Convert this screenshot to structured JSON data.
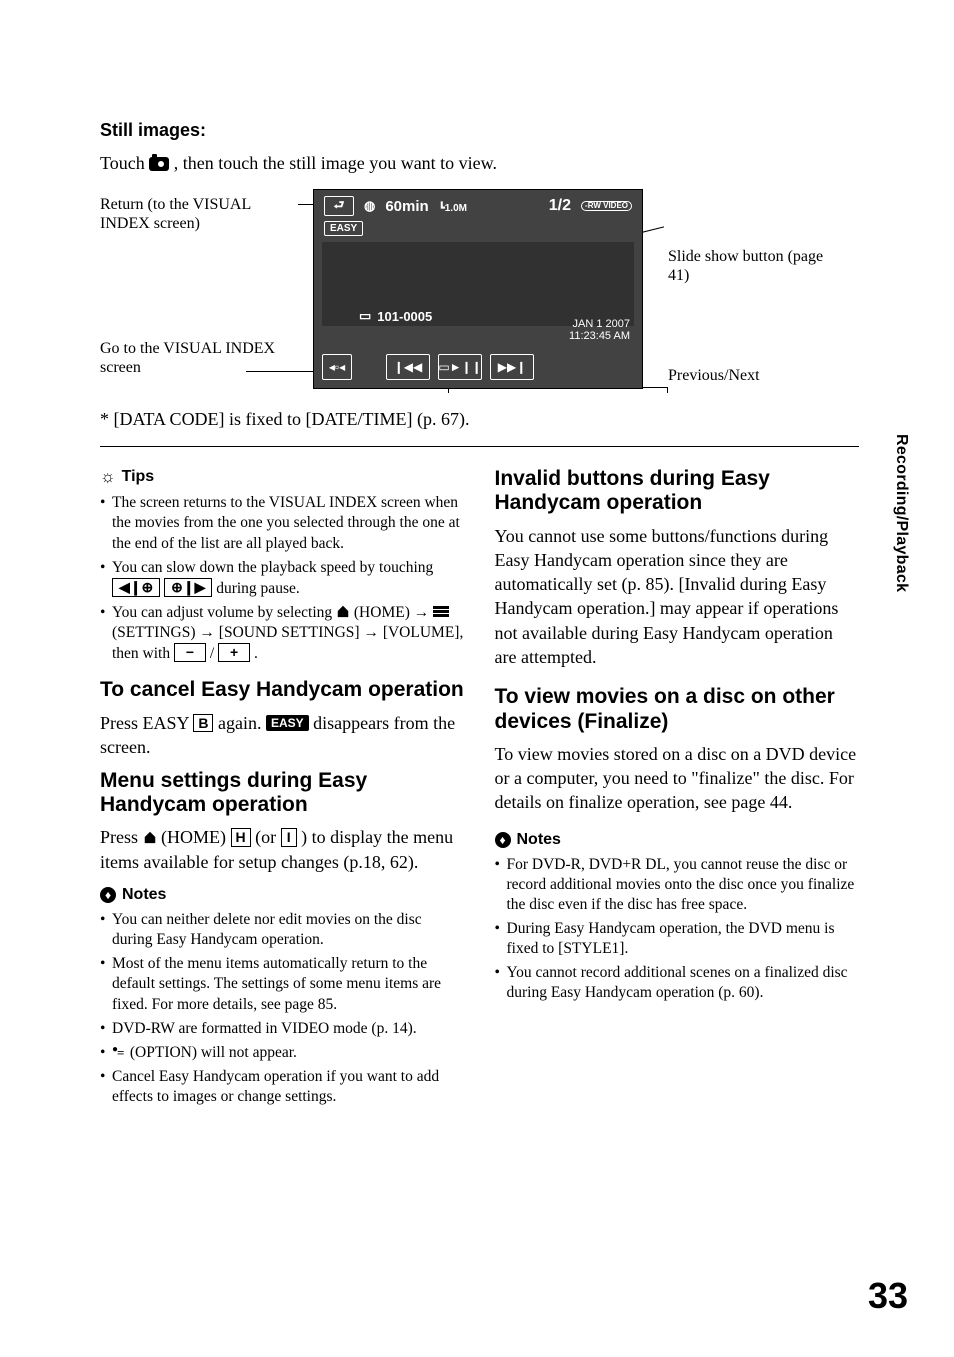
{
  "still_heading": "Still images:",
  "still_intro_a": "Touch ",
  "still_intro_b": " , then touch the still image you want to view.",
  "diagram": {
    "return_label": "Return (to the VISUAL INDEX screen)",
    "goto_label": "Go to the VISUAL INDEX screen",
    "slide_label": "Slide show button (page 41)",
    "prevnext_label": "Previous/Next",
    "sc_time": "60min",
    "sc_size": "1.0M",
    "sc_count": "1/2",
    "sc_media": "-RW VIDEO",
    "sc_easy": "EASY",
    "sc_folder": "101-0005",
    "sc_date": "JAN  1  2007",
    "sc_clock": "11:23:45 AM"
  },
  "footnote": "* [DATA CODE] is fixed to [DATE/TIME] (p. 67).",
  "tips_header": "Tips",
  "tips": {
    "t1": "The screen returns to the VISUAL INDEX screen when the movies from the one you selected through the one at the end of the list are all played back.",
    "t2a": "You can slow down the playback speed by touching ",
    "t2b": " during pause.",
    "t3a": "You can adjust volume by selecting ",
    "t3b": " (HOME) ",
    "t3c": " (SETTINGS) ",
    "t3d": " [SOUND SETTINGS] ",
    "t3e": " [VOLUME], then with ",
    "t3f": " / ",
    "t3g": " ."
  },
  "cancel_h": "To cancel Easy Handycam operation",
  "cancel_a": "Press EASY ",
  "cancel_key": "B",
  "cancel_b": " again. ",
  "cancel_badge": "EASY",
  "cancel_c": " disappears from the screen.",
  "menu_h": "Menu settings during Easy Handycam operation",
  "menu_a": "Press ",
  "menu_b": " (HOME) ",
  "menu_key1": "H",
  "menu_c": "(or ",
  "menu_key2": "I",
  "menu_d": ") to display the menu items available for setup changes (p.18, 62).",
  "notes_header": "Notes",
  "notes_left": {
    "n1": "You can neither delete nor edit movies on the disc during Easy Handycam operation.",
    "n2": "Most of the menu items automatically return to the default settings. The settings of some menu items are fixed. For more details, see page 85.",
    "n3": "DVD-RW are formatted in VIDEO mode (p. 14).",
    "n4a": "",
    "n4b": " (OPTION) will not appear.",
    "n5": "Cancel Easy Handycam operation if you want to add effects to images or change settings."
  },
  "invalid_h": "Invalid buttons during Easy Handycam operation",
  "invalid_body": "You cannot use some buttons/functions during Easy Handycam operation since they are automatically set (p. 85). [Invalid during Easy Handycam operation.] may appear if operations not available during Easy Handycam operation are attempted.",
  "finalize_h": "To view movies on a disc on other devices (Finalize)",
  "finalize_body": "To view movies stored on a disc on a DVD device or a computer, you need to \"finalize\" the disc. For details on finalize operation, see page 44.",
  "notes_right": {
    "n1": "For DVD-R, DVD+R DL, you cannot reuse the disc or record additional movies onto the disc once you finalize the disc even if the disc has free space.",
    "n2": "During Easy Handycam operation, the DVD menu is fixed to [STYLE1].",
    "n3": "You cannot record additional scenes on a finalized disc during Easy Handycam operation (p. 60)."
  },
  "icon_minus": "−",
  "icon_plus": "+",
  "slow_rev": "◀❙⊕",
  "slow_fwd": "⊕❙▶",
  "side_tab": "Recording/Playback",
  "page_number": "33"
}
